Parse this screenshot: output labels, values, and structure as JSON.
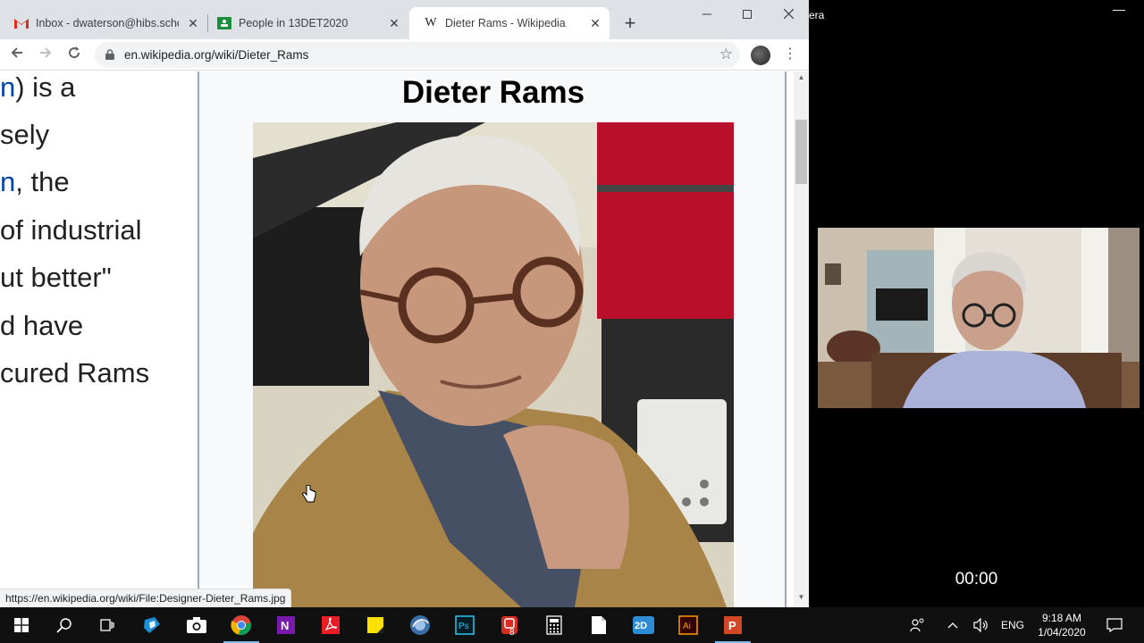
{
  "browser": {
    "tabs": [
      {
        "title": "Inbox - dwaterson@hibs.schoo",
        "favicon": "gmail-icon"
      },
      {
        "title": "People in 13DET2020",
        "favicon": "classroom-icon"
      },
      {
        "title": "Dieter Rams - Wikipedia",
        "favicon": "wikipedia-icon",
        "active": true
      }
    ],
    "close_glyph": "✕",
    "new_tab_glyph": "+",
    "url": "en.wikipedia.org/wiki/Dieter_Rams",
    "status_url": "https://en.wikipedia.org/wiki/File:Designer-Dieter_Rams.jpg"
  },
  "article": {
    "lines": [
      {
        "link": "n",
        "text": ") is a"
      },
      {
        "link": "",
        "text": "sely"
      },
      {
        "link": "n",
        "text": ", the"
      },
      {
        "link": "",
        "text": "of industrial"
      },
      {
        "link": "",
        "text": "ut better\""
      },
      {
        "link": "",
        "text": "d have"
      },
      {
        "link": "",
        "text": "cured Rams"
      }
    ]
  },
  "infobox": {
    "title": "Dieter Rams",
    "image": "portrait-photo"
  },
  "camera": {
    "title": "era",
    "timer": "00:00"
  },
  "taskbar": {
    "apps": [
      "windows-start-icon",
      "search-icon",
      "task-view-icon",
      "sketchup-icon",
      "camera-icon",
      "chrome-icon",
      "onenote-icon",
      "acrobat-icon",
      "sticky-notes-icon",
      "sound-recorder-icon",
      "photoshop-icon",
      "screencast-icon",
      "calculator-icon",
      "file-icon",
      "2d-design-icon",
      "illustrator-icon",
      "powerpoint-icon"
    ],
    "language": "ENG",
    "time": "9:18 AM",
    "date": "1/04/2020"
  },
  "colors": {
    "link": "#0645ad",
    "tabstrip": "#dee1e6",
    "taskbar": "#101010",
    "taskbar_active": "#76b9ed"
  }
}
